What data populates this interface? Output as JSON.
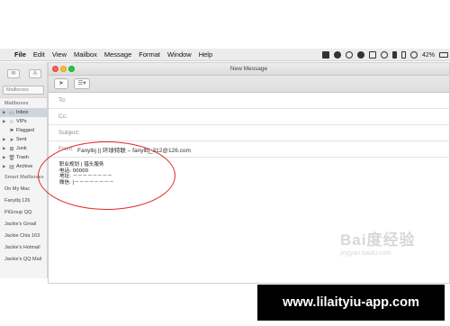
{
  "menubar": {
    "items": [
      "File",
      "Edit",
      "View",
      "Mailbox",
      "Message",
      "Format",
      "Window",
      "Help"
    ],
    "battery": "42%"
  },
  "sidebar": {
    "toolbar_mailboxes_label": "Mailboxes",
    "section_mailboxes": "Mailboxes",
    "items": [
      {
        "label": "Inbox",
        "icon": "inbox-icon",
        "glyph": "▭"
      },
      {
        "label": "VIPs",
        "icon": "star-icon",
        "glyph": "☆"
      },
      {
        "label": "Flagged",
        "icon": "flag-icon",
        "glyph": "⚑"
      },
      {
        "label": "Sent",
        "icon": "paper-plane-icon",
        "glyph": "➤"
      },
      {
        "label": "Junk",
        "icon": "junk-icon",
        "glyph": "⊠"
      },
      {
        "label": "Trash",
        "icon": "trash-icon",
        "glyph": "🗑"
      },
      {
        "label": "Archive",
        "icon": "archive-icon",
        "glyph": "▤"
      }
    ],
    "smart_mailboxes": "Smart Mailboxes",
    "accounts": [
      "On My Mac",
      "Fanylbj 126",
      "PiGroup QQ",
      "Jackie's Gmail",
      "Jackie Chia 163",
      "Jackie's Hotmail",
      "Jackie's QQ Mail"
    ]
  },
  "window": {
    "title": "New Message"
  },
  "fields": {
    "to_label": "To:",
    "cc_label": "Cc:",
    "subject_label": "Subject:",
    "from_label": "From:",
    "from_value": "Fanylbj || 环球特联 – fanylbj_312@126.com"
  },
  "body": {
    "line1": "职业规划 | 猎头服务",
    "line2": "电话: 00000",
    "line3": "地址: －－－－－－－－",
    "line4": "微信: |－－－－－－－－"
  },
  "watermark": {
    "main": "Bai度经验",
    "sub": "jingyan.baidu.com"
  },
  "banner": {
    "text": "www.lilaityiu-app.com"
  },
  "colors": {
    "annotation": "#e02a2a",
    "selected_row": "#d0d4dc",
    "banner_bg": "#000000"
  }
}
